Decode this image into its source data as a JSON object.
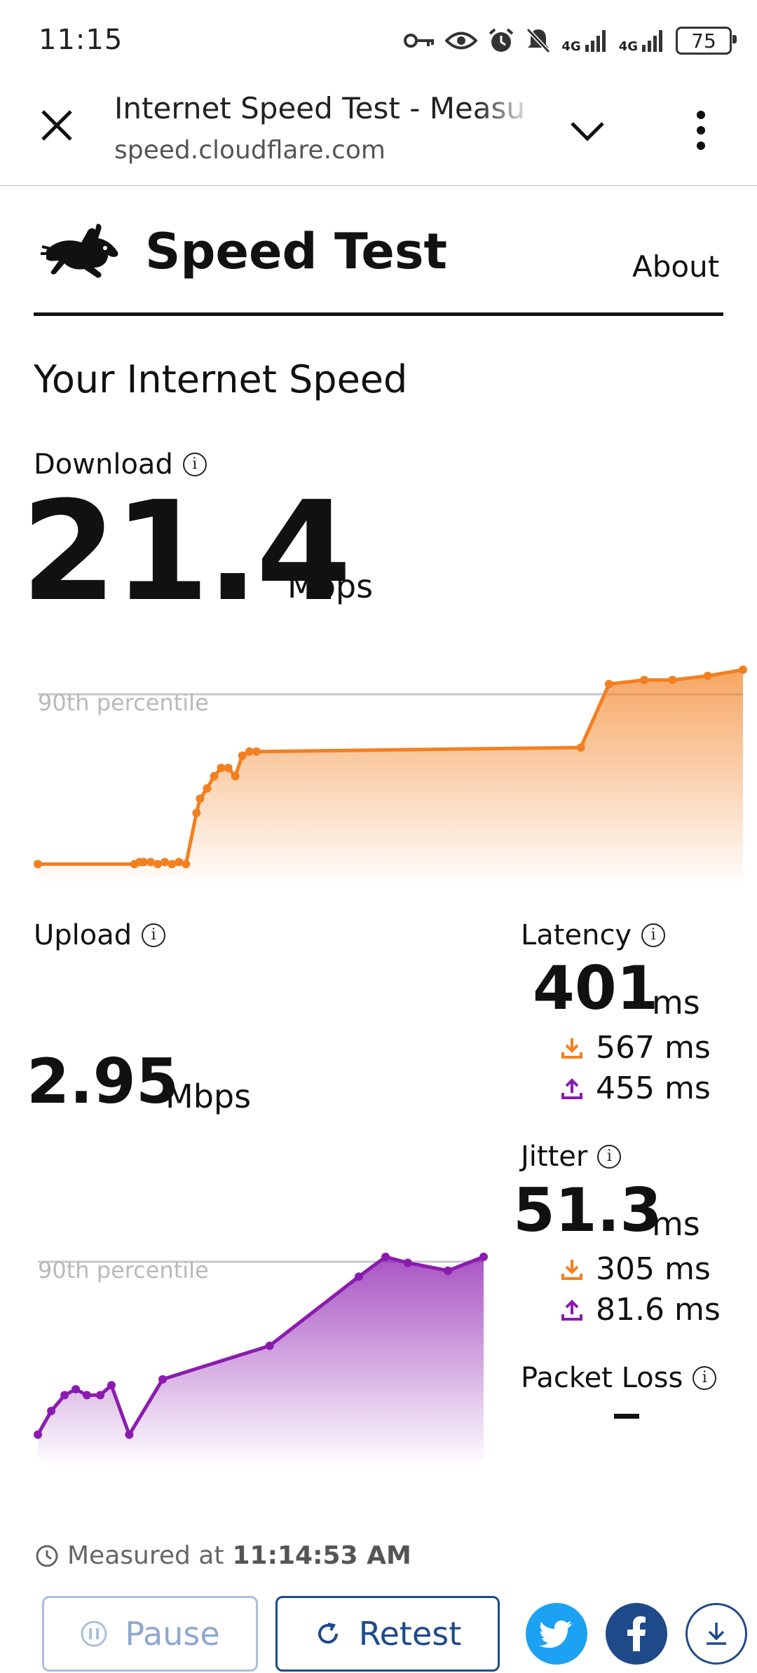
{
  "status": {
    "time": "11:15",
    "network1": "4G",
    "network2": "4G",
    "battery": "75"
  },
  "browser": {
    "title": "Internet Speed Test - Measu",
    "url": "speed.cloudflare.com"
  },
  "site": {
    "title": "Speed Test",
    "about": "About"
  },
  "section_title": "Your Internet Speed",
  "download": {
    "label": "Download",
    "value": "21.4",
    "unit": "Mbps",
    "percentile_label": "90th percentile",
    "color": "#f38020"
  },
  "upload": {
    "label": "Upload",
    "value": "2.95",
    "unit": "Mbps",
    "percentile_label": "90th percentile",
    "color": "#8b1bb0"
  },
  "latency": {
    "label": "Latency",
    "value": "401",
    "unit": "ms",
    "down": "567 ms",
    "up": "455 ms"
  },
  "jitter": {
    "label": "Jitter",
    "value": "51.3",
    "unit": "ms",
    "down": "305 ms",
    "up": "81.6 ms"
  },
  "packet_loss": {
    "label": "Packet Loss",
    "value": "–"
  },
  "measured": {
    "prefix": "Measured at",
    "time": "11:14:53 AM"
  },
  "buttons": {
    "pause": "Pause",
    "retest": "Retest"
  },
  "icons": [
    "key-icon",
    "eye-icon",
    "alarm-icon",
    "mute-icon",
    "signal-icon",
    "battery-icon",
    "close-icon",
    "chevron-down-icon",
    "more-vert-icon",
    "rabbit-logo-icon",
    "info-icon",
    "download-arrow-icon",
    "upload-arrow-icon",
    "clock-icon",
    "pause-icon",
    "refresh-icon",
    "twitter-icon",
    "facebook-icon",
    "download-icon"
  ],
  "chart_data": [
    {
      "type": "line",
      "series": [
        {
          "name": "Download",
          "values": [
            0.05,
            0.05,
            0.06,
            0.06,
            0.06,
            0.05,
            0.06,
            0.05,
            0.06,
            0.05,
            0.3,
            0.37,
            0.42,
            0.48,
            0.52,
            0.52,
            0.48,
            0.58,
            0.6,
            0.6,
            0.62,
            0.93,
            0.95,
            0.95,
            0.97,
            1.0
          ]
        }
      ],
      "percentile_line": 0.9
    },
    {
      "type": "line",
      "series": [
        {
          "name": "Upload",
          "values": [
            0.1,
            0.22,
            0.3,
            0.33,
            0.3,
            0.3,
            0.35,
            0.1,
            0.38,
            0.55,
            0.9,
            1.0,
            0.97,
            0.93,
            1.0
          ]
        }
      ],
      "percentile_line": 0.96
    }
  ]
}
